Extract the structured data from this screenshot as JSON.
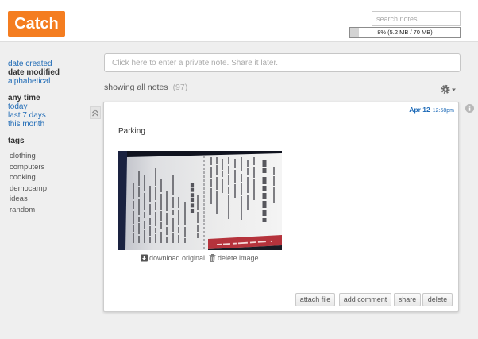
{
  "app": {
    "logo": "Catch"
  },
  "header": {
    "search_placeholder": "search notes",
    "storage": {
      "label": "8% (5.2 MB / 70 MB)",
      "used_percent": 8
    }
  },
  "sidebar": {
    "sort_options": [
      {
        "label": "date created",
        "selected": false
      },
      {
        "label": "date modified",
        "selected": true
      },
      {
        "label": "alphabetical",
        "selected": false
      }
    ],
    "time_options": [
      {
        "label": "any time",
        "selected": true
      },
      {
        "label": "today",
        "selected": false
      },
      {
        "label": "last 7 days",
        "selected": false
      },
      {
        "label": "this month",
        "selected": false
      }
    ],
    "tags_heading": "tags",
    "tags": [
      "clothing",
      "computers",
      "cooking",
      "democamp",
      "ideas",
      "random"
    ]
  },
  "composer": {
    "placeholder": "Click here to enter a private note. Share it later."
  },
  "list_header": {
    "label": "showing all notes",
    "count": "(97)"
  },
  "note": {
    "date": "Apr 12",
    "time": "12:58pm",
    "text": "Parking",
    "image_actions": {
      "download": "download original",
      "delete": "delete image"
    },
    "buttons": {
      "attach": "attach file",
      "comment": "add comment",
      "share": "share",
      "delete": "delete"
    }
  },
  "icons": {
    "settings": "gear-icon",
    "settings_menu": "caret-down-icon",
    "collapse": "double-chevron-up-icon",
    "info": "info-icon",
    "download": "download-icon",
    "delete_image": "trash-icon"
  },
  "colors": {
    "brand": "#f47d20",
    "link": "#1f6bb6",
    "timestamp": "#1e6bb8"
  }
}
